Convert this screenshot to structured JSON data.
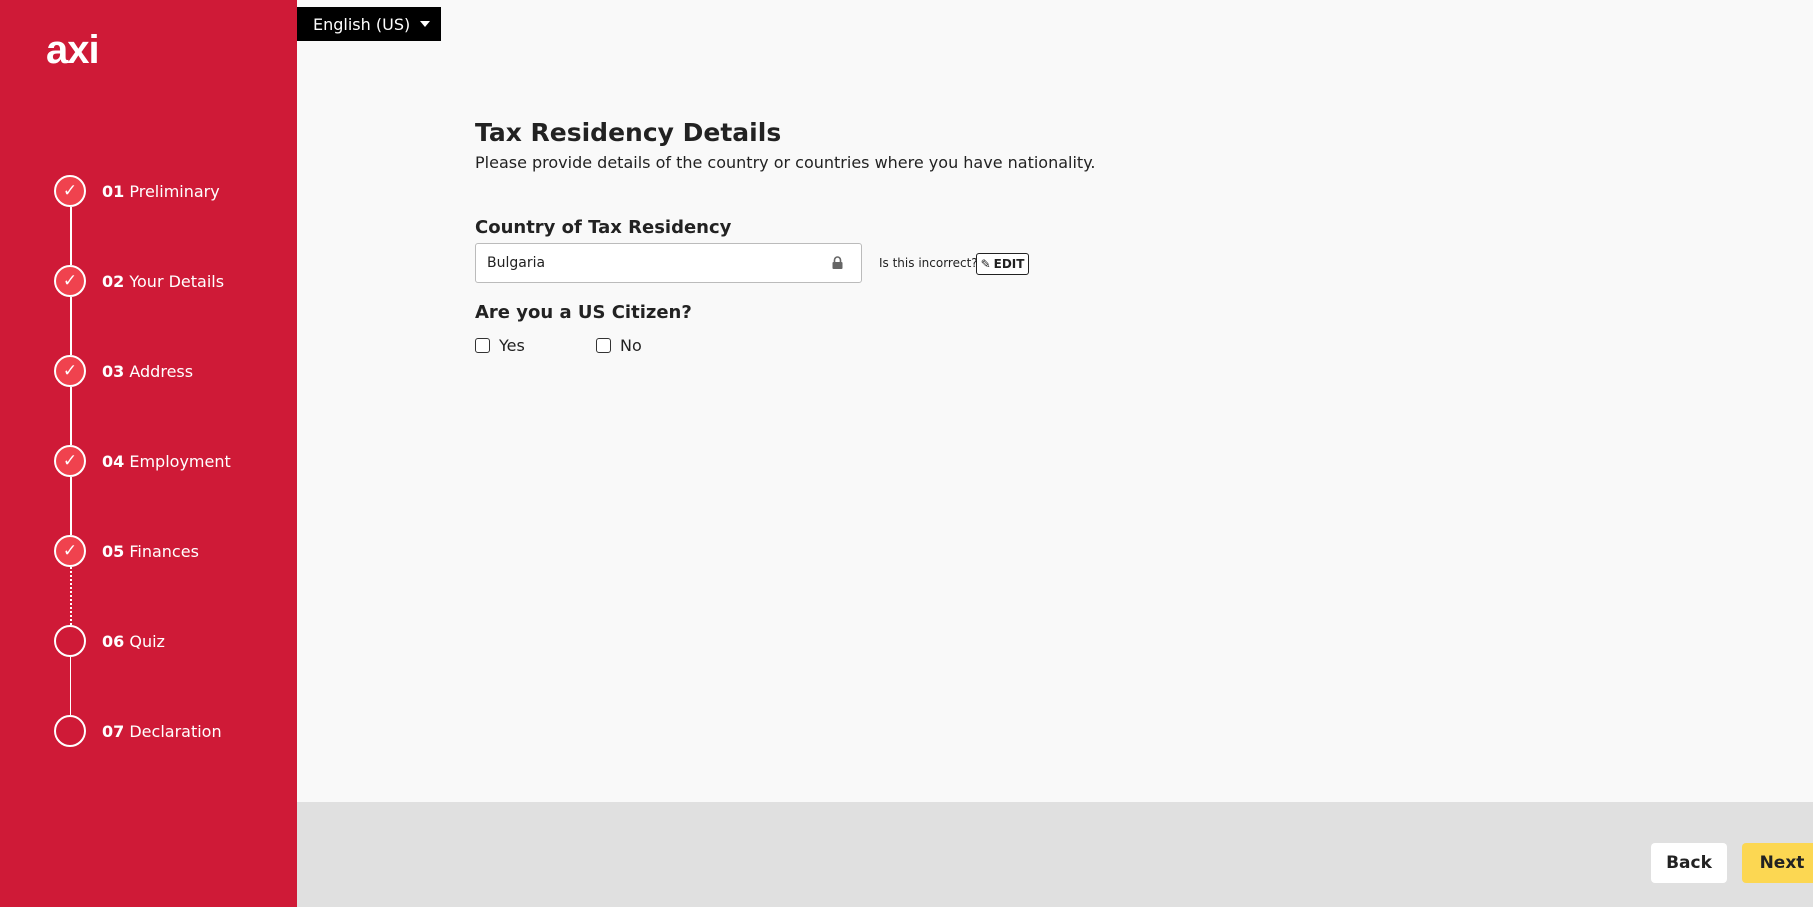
{
  "brand": {
    "logo": "axi",
    "sidebar_color": "#cf1a37",
    "accent_yellow": "#fcd752"
  },
  "language": {
    "selected": "English (US)"
  },
  "steps": [
    {
      "num": "01",
      "label": "Preliminary",
      "status": "complete"
    },
    {
      "num": "02",
      "label": "Your Details",
      "status": "complete"
    },
    {
      "num": "03",
      "label": "Address",
      "status": "complete"
    },
    {
      "num": "04",
      "label": "Employment",
      "status": "complete"
    },
    {
      "num": "05",
      "label": "Finances",
      "status": "complete"
    },
    {
      "num": "06",
      "label": "Quiz",
      "status": "pending"
    },
    {
      "num": "07",
      "label": "Declaration",
      "status": "pending"
    }
  ],
  "form": {
    "title": "Tax Residency Details",
    "subtitle": "Please provide details of the country or countries where you have nationality.",
    "country_label": "Country of Tax Residency",
    "country_value": "Bulgaria",
    "incorrect_text": "Is this incorrect?",
    "edit_label": "EDIT",
    "us_citizen_label": "Are you a US Citizen?",
    "yes_label": "Yes",
    "no_label": "No"
  },
  "footer": {
    "back_label": "Back",
    "next_label": "Next"
  }
}
